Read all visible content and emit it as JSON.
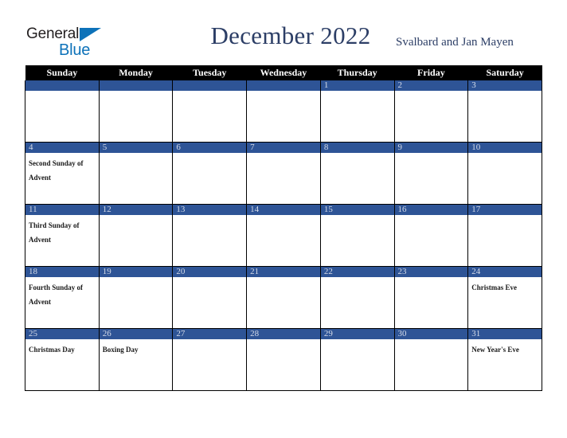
{
  "brand": {
    "name_part1": "General",
    "name_part2": "Blue",
    "triangle_color": "#0d72b9",
    "text_color": "#231f20"
  },
  "header": {
    "title": "December 2022",
    "location": "Svalbard and Jan Mayen",
    "title_color": "#2c3e66"
  },
  "calendar": {
    "weekday_headers": [
      "Sunday",
      "Monday",
      "Tuesday",
      "Wednesday",
      "Thursday",
      "Friday",
      "Saturday"
    ],
    "header_bg": "#000000",
    "daynum_bg": "#2e5496",
    "daynum_color": "#d6dce9",
    "weeks": [
      [
        {
          "day": "",
          "event": ""
        },
        {
          "day": "",
          "event": ""
        },
        {
          "day": "",
          "event": ""
        },
        {
          "day": "",
          "event": ""
        },
        {
          "day": "1",
          "event": ""
        },
        {
          "day": "2",
          "event": ""
        },
        {
          "day": "3",
          "event": ""
        }
      ],
      [
        {
          "day": "4",
          "event": "Second Sunday of Advent"
        },
        {
          "day": "5",
          "event": ""
        },
        {
          "day": "6",
          "event": ""
        },
        {
          "day": "7",
          "event": ""
        },
        {
          "day": "8",
          "event": ""
        },
        {
          "day": "9",
          "event": ""
        },
        {
          "day": "10",
          "event": ""
        }
      ],
      [
        {
          "day": "11",
          "event": "Third Sunday of Advent"
        },
        {
          "day": "12",
          "event": ""
        },
        {
          "day": "13",
          "event": ""
        },
        {
          "day": "14",
          "event": ""
        },
        {
          "day": "15",
          "event": ""
        },
        {
          "day": "16",
          "event": ""
        },
        {
          "day": "17",
          "event": ""
        }
      ],
      [
        {
          "day": "18",
          "event": "Fourth Sunday of Advent"
        },
        {
          "day": "19",
          "event": ""
        },
        {
          "day": "20",
          "event": ""
        },
        {
          "day": "21",
          "event": ""
        },
        {
          "day": "22",
          "event": ""
        },
        {
          "day": "23",
          "event": ""
        },
        {
          "day": "24",
          "event": "Christmas Eve"
        }
      ],
      [
        {
          "day": "25",
          "event": "Christmas Day"
        },
        {
          "day": "26",
          "event": "Boxing Day"
        },
        {
          "day": "27",
          "event": ""
        },
        {
          "day": "28",
          "event": ""
        },
        {
          "day": "29",
          "event": ""
        },
        {
          "day": "30",
          "event": ""
        },
        {
          "day": "31",
          "event": "New Year's Eve"
        }
      ]
    ]
  }
}
